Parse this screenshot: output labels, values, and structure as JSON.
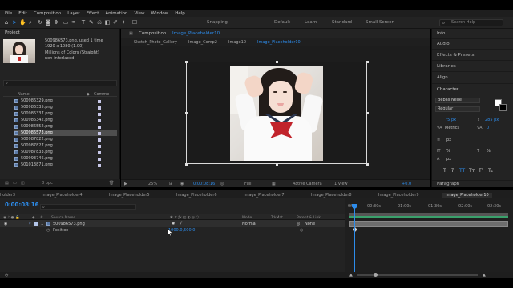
{
  "menu": [
    "File",
    "Edit",
    "Composition",
    "Layer",
    "Effect",
    "Animation",
    "View",
    "Window",
    "Help"
  ],
  "toolbar": {
    "snapping": "Snapping",
    "workspaces": [
      "Default",
      "Learn",
      "Standard",
      "Small Screen"
    ],
    "search_placeholder": "Search Help"
  },
  "project": {
    "tab": "Project",
    "item_name": "500986573.png",
    "item_used": ", used 1 time",
    "item_dims": "1920 x 1080 (1.00)",
    "item_color": "Millions of Colors (Straight)",
    "item_interlace": "non-interlaced",
    "col_name": "Name",
    "col_comment": "Comme",
    "files": [
      "500986329.png",
      "500986335.png",
      "500986337.png",
      "500986342.png",
      "500986552.png",
      "500986573.png",
      "500987822.png",
      "500987827.png",
      "500987833.png",
      "500993746.png",
      "501013871.png"
    ],
    "selected_file": "500986573.png",
    "bpc": "8 bpc"
  },
  "comp": {
    "tab": "Composition",
    "tab_name": "Image_Placeholder10",
    "crumbs": [
      "Sketch_Photo_Gallery",
      "Image_Comp2",
      "Image10",
      "Image_Placeholder10"
    ],
    "zoom": "25%",
    "timecode": "0:00:08:16",
    "resolution": "Full",
    "camera": "Active Camera",
    "views": "1 View",
    "exposure": "+0.0"
  },
  "right_panel": {
    "items": [
      "Info",
      "Audio",
      "Effects & Presets",
      "Libraries",
      "Align"
    ],
    "character": "Character",
    "font": "Bebas Neue",
    "style": "Regular",
    "size": "75 px",
    "leading": "285 px",
    "kerning": "Metrics",
    "tracking": "0",
    "units": "px",
    "baseline": "px",
    "scale_v": "%",
    "scale_h": "%",
    "paragraph": "Paragraph"
  },
  "timeline": {
    "tabs": [
      "holder3",
      "Image_Placeholder4",
      "Image_Placeholder5",
      "Image_Placeholder6",
      "Image_Placeholder7",
      "Image_Placeholder8",
      "Image_Placeholder9",
      "Image_Placeholder10"
    ],
    "active_tab": "Image_Placeholder10",
    "timecode": "0:00:08:16",
    "hdr_source": "Source Name",
    "hdr_mode": "Mode",
    "hdr_trkmat": "TrkMat",
    "hdr_parent": "Parent & Link",
    "layer_num": "1",
    "layer_name": "500986573.png",
    "layer_mode": "Norma",
    "layer_parent": "None",
    "prop_name": "Position",
    "prop_value": "1000.0,500.0",
    "ruler": [
      "0f",
      "00:30s",
      "01:00s",
      "01:30s",
      "02:00s",
      "02:30s"
    ]
  },
  "colors": {
    "accent": "#2d8ceb",
    "panel": "#232323",
    "background": "#1d1d1d"
  }
}
